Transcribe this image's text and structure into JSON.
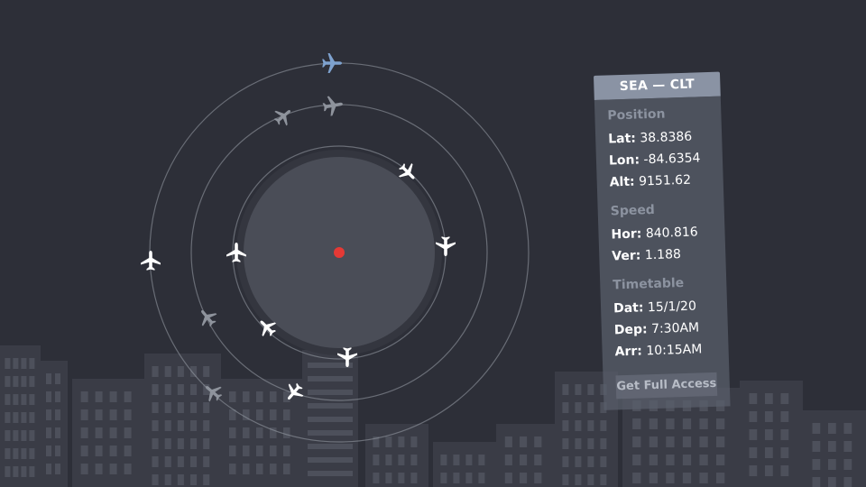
{
  "colors": {
    "background": "#2d2f38",
    "inner_disc": "#4a4d57",
    "center_dot": "#e53935",
    "plane_primary": "#ffffff",
    "plane_dim": "#8e939c",
    "plane_selected": "#7ea2cf",
    "panel_header": "#8a93a4"
  },
  "flight_panel": {
    "route": "SEA — CLT",
    "sections": [
      {
        "title": "Position",
        "rows": [
          {
            "key": "Lat:",
            "value": "38.8386"
          },
          {
            "key": "Lon:",
            "value": "-84.6354"
          },
          {
            "key": "Alt:",
            "value": "9151.62"
          }
        ]
      },
      {
        "title": "Speed",
        "rows": [
          {
            "key": "Hor:",
            "value": "840.816"
          },
          {
            "key": "Ver:",
            "value": "1.188"
          }
        ]
      },
      {
        "title": "Timetable",
        "rows": [
          {
            "key": "Dat:",
            "value": "15/1/20"
          },
          {
            "key": "Dep:",
            "value": "7:30AM"
          },
          {
            "key": "Arr:",
            "value": "10:15AM"
          }
        ]
      }
    ],
    "access_button": "Get Full Access"
  },
  "radar": {
    "planes": [
      {
        "name": "plane-selected-icon",
        "icon": "airplane-icon",
        "color": "selected"
      },
      {
        "name": "plane-icon",
        "icon": "airplane-icon",
        "color": "dim"
      },
      {
        "name": "plane-icon",
        "icon": "airplane-icon",
        "color": "dim"
      },
      {
        "name": "plane-icon",
        "icon": "airplane-icon",
        "color": "primary"
      },
      {
        "name": "plane-icon",
        "icon": "airplane-icon",
        "color": "primary"
      },
      {
        "name": "plane-icon",
        "icon": "airplane-icon",
        "color": "primary"
      },
      {
        "name": "plane-icon",
        "icon": "airplane-icon",
        "color": "primary"
      },
      {
        "name": "plane-icon",
        "icon": "airplane-icon",
        "color": "dim"
      },
      {
        "name": "plane-icon",
        "icon": "airplane-icon",
        "color": "primary"
      },
      {
        "name": "plane-icon",
        "icon": "airplane-icon",
        "color": "primary"
      },
      {
        "name": "plane-icon",
        "icon": "airplane-icon",
        "color": "dim"
      },
      {
        "name": "plane-icon",
        "icon": "airplane-icon",
        "color": "primary"
      }
    ]
  }
}
